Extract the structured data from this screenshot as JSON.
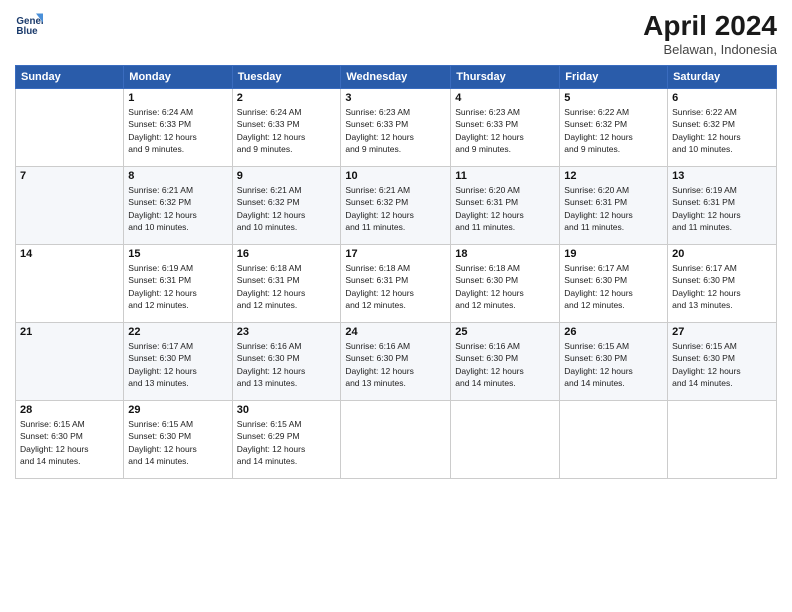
{
  "logo": {
    "line1": "General",
    "line2": "Blue"
  },
  "title": "April 2024",
  "subtitle": "Belawan, Indonesia",
  "days_of_week": [
    "Sunday",
    "Monday",
    "Tuesday",
    "Wednesday",
    "Thursday",
    "Friday",
    "Saturday"
  ],
  "weeks": [
    [
      {
        "day": "",
        "info": ""
      },
      {
        "day": "1",
        "info": "Sunrise: 6:24 AM\nSunset: 6:33 PM\nDaylight: 12 hours\nand 9 minutes."
      },
      {
        "day": "2",
        "info": "Sunrise: 6:24 AM\nSunset: 6:33 PM\nDaylight: 12 hours\nand 9 minutes."
      },
      {
        "day": "3",
        "info": "Sunrise: 6:23 AM\nSunset: 6:33 PM\nDaylight: 12 hours\nand 9 minutes."
      },
      {
        "day": "4",
        "info": "Sunrise: 6:23 AM\nSunset: 6:33 PM\nDaylight: 12 hours\nand 9 minutes."
      },
      {
        "day": "5",
        "info": "Sunrise: 6:22 AM\nSunset: 6:32 PM\nDaylight: 12 hours\nand 9 minutes."
      },
      {
        "day": "6",
        "info": "Sunrise: 6:22 AM\nSunset: 6:32 PM\nDaylight: 12 hours\nand 10 minutes."
      }
    ],
    [
      {
        "day": "7",
        "info": ""
      },
      {
        "day": "8",
        "info": "Sunrise: 6:21 AM\nSunset: 6:32 PM\nDaylight: 12 hours\nand 10 minutes."
      },
      {
        "day": "9",
        "info": "Sunrise: 6:21 AM\nSunset: 6:32 PM\nDaylight: 12 hours\nand 10 minutes."
      },
      {
        "day": "10",
        "info": "Sunrise: 6:21 AM\nSunset: 6:32 PM\nDaylight: 12 hours\nand 11 minutes."
      },
      {
        "day": "11",
        "info": "Sunrise: 6:20 AM\nSunset: 6:31 PM\nDaylight: 12 hours\nand 11 minutes."
      },
      {
        "day": "12",
        "info": "Sunrise: 6:20 AM\nSunset: 6:31 PM\nDaylight: 12 hours\nand 11 minutes."
      },
      {
        "day": "13",
        "info": "Sunrise: 6:19 AM\nSunset: 6:31 PM\nDaylight: 12 hours\nand 11 minutes."
      }
    ],
    [
      {
        "day": "14",
        "info": ""
      },
      {
        "day": "15",
        "info": "Sunrise: 6:19 AM\nSunset: 6:31 PM\nDaylight: 12 hours\nand 12 minutes."
      },
      {
        "day": "16",
        "info": "Sunrise: 6:18 AM\nSunset: 6:31 PM\nDaylight: 12 hours\nand 12 minutes."
      },
      {
        "day": "17",
        "info": "Sunrise: 6:18 AM\nSunset: 6:31 PM\nDaylight: 12 hours\nand 12 minutes."
      },
      {
        "day": "18",
        "info": "Sunrise: 6:18 AM\nSunset: 6:30 PM\nDaylight: 12 hours\nand 12 minutes."
      },
      {
        "day": "19",
        "info": "Sunrise: 6:17 AM\nSunset: 6:30 PM\nDaylight: 12 hours\nand 12 minutes."
      },
      {
        "day": "20",
        "info": "Sunrise: 6:17 AM\nSunset: 6:30 PM\nDaylight: 12 hours\nand 13 minutes."
      }
    ],
    [
      {
        "day": "21",
        "info": ""
      },
      {
        "day": "22",
        "info": "Sunrise: 6:17 AM\nSunset: 6:30 PM\nDaylight: 12 hours\nand 13 minutes."
      },
      {
        "day": "23",
        "info": "Sunrise: 6:16 AM\nSunset: 6:30 PM\nDaylight: 12 hours\nand 13 minutes."
      },
      {
        "day": "24",
        "info": "Sunrise: 6:16 AM\nSunset: 6:30 PM\nDaylight: 12 hours\nand 13 minutes."
      },
      {
        "day": "25",
        "info": "Sunrise: 6:16 AM\nSunset: 6:30 PM\nDaylight: 12 hours\nand 14 minutes."
      },
      {
        "day": "26",
        "info": "Sunrise: 6:15 AM\nSunset: 6:30 PM\nDaylight: 12 hours\nand 14 minutes."
      },
      {
        "day": "27",
        "info": "Sunrise: 6:15 AM\nSunset: 6:30 PM\nDaylight: 12 hours\nand 14 minutes."
      }
    ],
    [
      {
        "day": "28",
        "info": "Sunrise: 6:15 AM\nSunset: 6:30 PM\nDaylight: 12 hours\nand 14 minutes."
      },
      {
        "day": "29",
        "info": "Sunrise: 6:15 AM\nSunset: 6:30 PM\nDaylight: 12 hours\nand 14 minutes."
      },
      {
        "day": "30",
        "info": "Sunrise: 6:15 AM\nSunset: 6:29 PM\nDaylight: 12 hours\nand 14 minutes."
      },
      {
        "day": "",
        "info": ""
      },
      {
        "day": "",
        "info": ""
      },
      {
        "day": "",
        "info": ""
      },
      {
        "day": "",
        "info": ""
      }
    ]
  ]
}
